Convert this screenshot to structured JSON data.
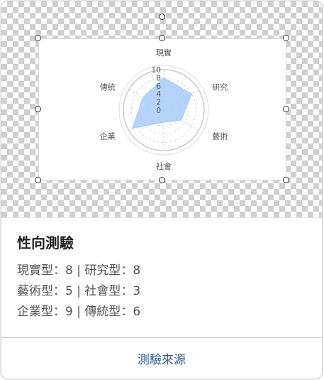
{
  "card": {
    "title": "性向測驗",
    "lines": [
      "現實型：8 | 研究型：8",
      "藝術型：5 | 社會型：3",
      "企業型：9 | 傳統型：6"
    ],
    "source_link": "測驗來源"
  },
  "colors": {
    "fill": "#a9cdfa",
    "grid": "#cccccc",
    "text": "#555555",
    "link": "#3c5f8f"
  },
  "chart_data": {
    "type": "radar",
    "title": "",
    "categories": [
      "現實",
      "研究",
      "藝術",
      "社會",
      "企業",
      "傳統"
    ],
    "values": [
      8,
      8,
      5,
      3,
      9,
      6
    ],
    "rlim": [
      0,
      10
    ],
    "ticks": [
      0,
      2,
      4,
      6,
      8,
      10
    ],
    "grid": true,
    "legend": "none"
  }
}
